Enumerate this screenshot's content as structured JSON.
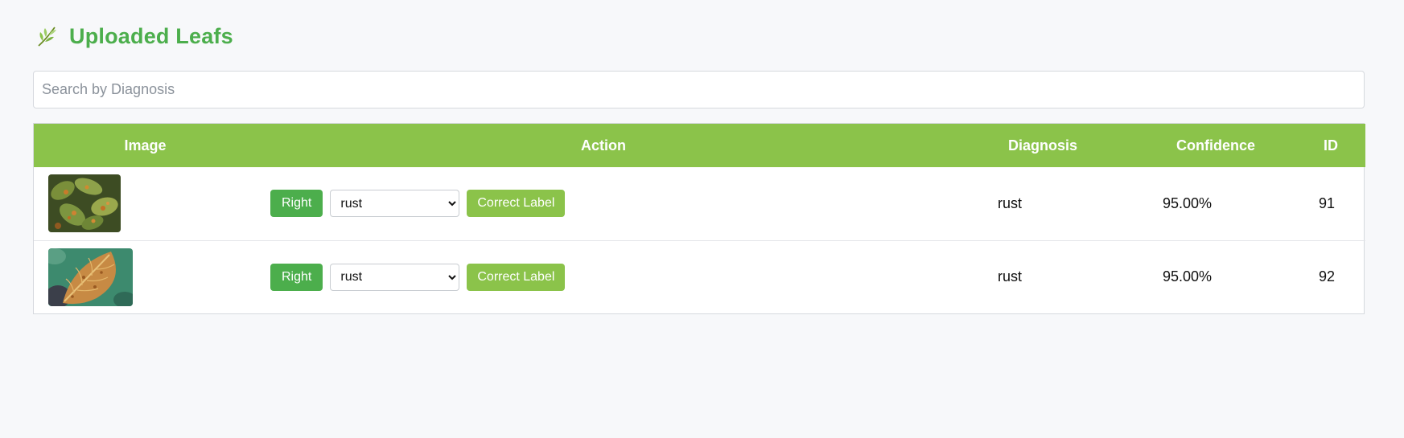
{
  "header": {
    "title": "Uploaded Leafs",
    "icon": "leaf-icon"
  },
  "search": {
    "placeholder": "Search by Diagnosis",
    "value": ""
  },
  "table": {
    "columns": [
      "Image",
      "Action",
      "Diagnosis",
      "Confidence",
      "ID"
    ],
    "rows": [
      {
        "image": "leaf-thumbnail-91",
        "right_label": "Right",
        "select_value": "rust",
        "correct_label": "Correct Label",
        "diagnosis": "rust",
        "confidence": "95.00%",
        "id": "91"
      },
      {
        "image": "leaf-thumbnail-92",
        "right_label": "Right",
        "select_value": "rust",
        "correct_label": "Correct Label",
        "diagnosis": "rust",
        "confidence": "95.00%",
        "id": "92"
      }
    ]
  },
  "colors": {
    "accent_green": "#4cae4c",
    "header_green": "#8bc34a",
    "background": "#f7f8fa"
  }
}
